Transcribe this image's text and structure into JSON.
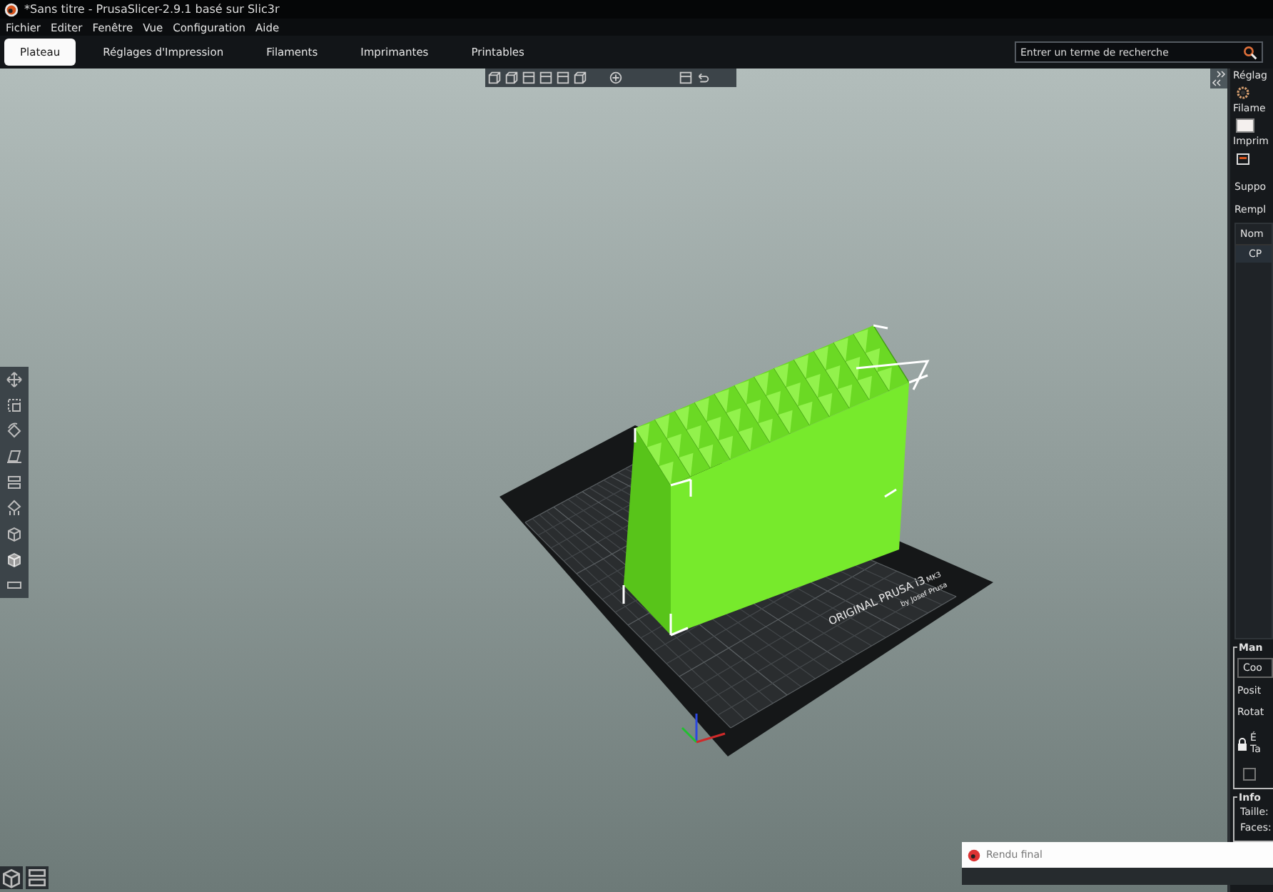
{
  "window": {
    "title": "*Sans titre - PrusaSlicer-2.9.1 basé sur Slic3r"
  },
  "menu": [
    "Fichier",
    "Editer",
    "Fenêtre",
    "Vue",
    "Configuration",
    "Aide"
  ],
  "tabs": [
    {
      "label": "Plateau",
      "selected": true
    },
    {
      "label": "Réglages d'Impression",
      "selected": false
    },
    {
      "label": "Filaments",
      "selected": false
    },
    {
      "label": "Imprimantes",
      "selected": false
    },
    {
      "label": "Printables",
      "selected": false
    }
  ],
  "search": {
    "placeholder": "Entrer un terme de recherche"
  },
  "bed": {
    "brand": "ORIGINAL PRUSA i3",
    "model": "MK3",
    "maker": "by Josef Prusa"
  },
  "sidebar": {
    "presets": [
      {
        "label": "Réglag",
        "kind": "gear"
      },
      {
        "label": "Filame",
        "kind": "swatch"
      },
      {
        "label": "Imprim",
        "kind": "printer"
      }
    ],
    "options": [
      "Suppo",
      "Rempl"
    ],
    "object_list": {
      "column": "Nom",
      "rows": [
        "CP"
      ]
    },
    "manipulation": {
      "title": "Man",
      "combo": "Coo",
      "labels": [
        "Posit",
        "Rotat"
      ],
      "lock_labels": [
        "É",
        "Ta"
      ],
      "checkbox": {
        "checked": false
      }
    },
    "info": {
      "title": "Info",
      "labels": [
        "Taille:",
        "Faces:"
      ]
    }
  },
  "notification": {
    "text": "Rendu final"
  }
}
